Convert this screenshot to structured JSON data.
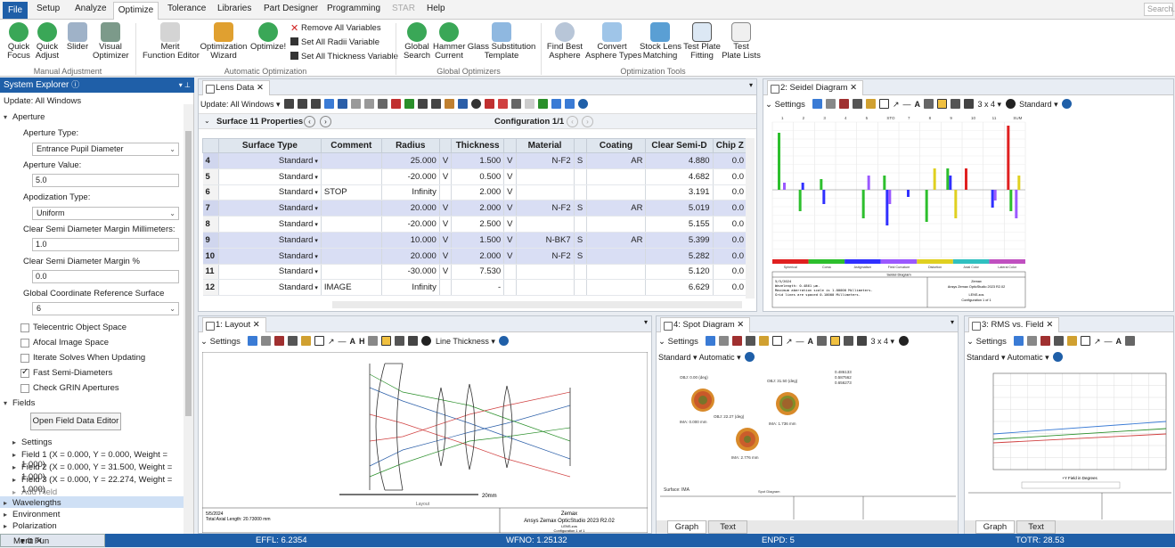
{
  "menu": {
    "file": "File",
    "setup": "Setup",
    "analyze": "Analyze",
    "optimize": "Optimize",
    "tolerance": "Tolerance",
    "libraries": "Libraries",
    "part_designer": "Part Designer",
    "programming": "Programming",
    "star": "STAR",
    "help": "Help",
    "search_placeholder": "Search..."
  },
  "ribbon": {
    "quick_focus": "Quick\nFocus",
    "quick_adjust": "Quick\nAdjust",
    "slider": "Slider",
    "visual_optimizer": "Visual\nOptimizer",
    "group_manual": "Manual Adjustment",
    "merit_editor": "Merit\nFunction Editor",
    "opt_wizard": "Optimization\nWizard",
    "optimize": "Optimize!",
    "remove_vars": "Remove All Variables",
    "set_radii": "Set All Radii Variable",
    "set_thickness": "Set All Thickness Variable",
    "group_auto": "Automatic Optimization",
    "global_search": "Global\nSearch",
    "hammer": "Hammer\nCurrent",
    "glass_sub": "Glass Substitution\nTemplate",
    "group_global": "Global Optimizers",
    "find_asphere": "Find Best\nAsphere",
    "convert_asphere": "Convert\nAsphere Types",
    "stock_lens": "Stock Lens\nMatching",
    "test_plate_fit": "Test Plate\nFitting",
    "test_plate_lists": "Test\nPlate Lists",
    "group_tools": "Optimization Tools"
  },
  "sysexp": {
    "title": "System Explorer",
    "update": "Update: All Windows",
    "aperture": "Aperture",
    "aperture_type_lbl": "Aperture Type:",
    "aperture_type": "Entrance Pupil Diameter",
    "aperture_value_lbl": "Aperture Value:",
    "aperture_value": "5.0",
    "apod_lbl": "Apodization Type:",
    "apod": "Uniform",
    "csd_mm_lbl": "Clear Semi Diameter Margin Millimeters:",
    "csd_mm": "1.0",
    "csd_pct_lbl": "Clear Semi Diameter Margin %",
    "csd_pct": "0.0",
    "gcrs_lbl": "Global Coordinate Reference Surface",
    "gcrs": "6",
    "telecentric": "Telecentric Object Space",
    "afocal": "Afocal Image Space",
    "iterate": "Iterate Solves When Updating",
    "fast_semi": "Fast Semi-Diameters",
    "check_grin": "Check GRIN Apertures",
    "fields": "Fields",
    "open_field": "Open Field Data Editor",
    "settings": "Settings",
    "field1": "Field 1 (X = 0.000, Y = 0.000, Weight = 1.000)",
    "field2": "Field 2 (X = 0.000, Y = 31.500, Weight = 1.000)",
    "field3": "Field 3 (X = 0.000, Y = 22.274, Weight = 1.000)",
    "add_field": "Add Field",
    "wavelengths": "Wavelengths",
    "environment": "Environment",
    "polarization": "Polarization"
  },
  "lens": {
    "tab": "Lens Data",
    "update": "Update: All Windows",
    "surface_label": "Surface",
    "surface_props": "11 Properties",
    "config": "Configuration 1/1",
    "headers": [
      "",
      "Surface Type",
      "Comment",
      "Radius",
      "",
      "Thickness",
      "",
      "Material",
      "",
      "Coating",
      "Clear Semi-D",
      "Chip Z"
    ],
    "rows": [
      {
        "n": "4",
        "type": "Standard",
        "comment": "",
        "radius": "25.000",
        "rs": "V",
        "thick": "1.500",
        "ts": "V",
        "mat": "N-F2",
        "ms": "S",
        "coat": "AR",
        "csd": "4.880",
        "chip": "0.0",
        "sel": true
      },
      {
        "n": "5",
        "type": "Standard",
        "comment": "",
        "radius": "-20.000",
        "rs": "V",
        "thick": "0.500",
        "ts": "V",
        "mat": "",
        "ms": "",
        "coat": "",
        "csd": "4.682",
        "chip": "0.0",
        "sel": false
      },
      {
        "n": "6",
        "type": "Standard",
        "comment": "STOP",
        "radius": "Infinity",
        "rs": "",
        "thick": "2.000",
        "ts": "V",
        "mat": "",
        "ms": "",
        "coat": "",
        "csd": "3.191",
        "chip": "0.0",
        "sel": false
      },
      {
        "n": "7",
        "type": "Standard",
        "comment": "",
        "radius": "20.000",
        "rs": "V",
        "thick": "2.000",
        "ts": "V",
        "mat": "N-F2",
        "ms": "S",
        "coat": "AR",
        "csd": "5.019",
        "chip": "0.0",
        "sel": true
      },
      {
        "n": "8",
        "type": "Standard",
        "comment": "",
        "radius": "-20.000",
        "rs": "V",
        "thick": "2.500",
        "ts": "V",
        "mat": "",
        "ms": "",
        "coat": "",
        "csd": "5.155",
        "chip": "0.0",
        "sel": false
      },
      {
        "n": "9",
        "type": "Standard",
        "comment": "",
        "radius": "10.000",
        "rs": "V",
        "thick": "1.500",
        "ts": "V",
        "mat": "N-BK7",
        "ms": "S",
        "coat": "AR",
        "csd": "5.399",
        "chip": "0.0",
        "sel": true
      },
      {
        "n": "10",
        "type": "Standard",
        "comment": "",
        "radius": "20.000",
        "rs": "V",
        "thick": "2.000",
        "ts": "V",
        "mat": "N-F2",
        "ms": "S",
        "coat": "",
        "csd": "5.282",
        "chip": "0.0",
        "sel": true
      },
      {
        "n": "11",
        "type": "Standard",
        "comment": "",
        "radius": "-30.000",
        "rs": "V",
        "thick": "7.530",
        "ts": "",
        "mat": "",
        "ms": "",
        "coat": "",
        "csd": "5.120",
        "chip": "0.0",
        "sel": false
      },
      {
        "n": "12",
        "type": "Standard",
        "comment": "IMAGE",
        "radius": "Infinity",
        "rs": "",
        "thick": "-",
        "ts": "",
        "mat": "",
        "ms": "",
        "coat": "",
        "csd": "6.629",
        "chip": "0.0",
        "sel": false
      }
    ]
  },
  "seidel": {
    "tab": "2: Seidel Diagram",
    "settings": "Settings",
    "grid": "3 x 4",
    "standard": "Standard",
    "stop": "STO",
    "sum": "SUM",
    "legend": [
      "Spherical",
      "Coma",
      "Astigmatism",
      "Field Curvature",
      "Distortion",
      "Axial Color",
      "Lateral Color"
    ],
    "legend_colors": [
      "#e02020",
      "#2dbf2d",
      "#3030ff",
      "#9b59ff",
      "#e0d020",
      "#30c0c0",
      "#c050c0"
    ],
    "footer_title": "Seidel Diagram",
    "footer_lines": [
      "5/5/2024",
      "Wavelength: 0.4861 µm.",
      "Maximum aberration scale is 1.00000 Millimeters.",
      "Grid lines are spaced 0.10000 Millimeters."
    ],
    "footer_company": "Zemax",
    "footer_product": "Ansys Zemax OpticStudio 2023 R2.02",
    "footer_file": "LENS.zos",
    "footer_config": "Configuration 1 of 1"
  },
  "layout": {
    "tab": "1: Layout",
    "settings": "Settings",
    "line_thickness": "Line Thickness",
    "scale": "20mm",
    "caption": "Layout",
    "date": "5/5/2024",
    "total_axial": "Total Axial Length:  20.73000 mm",
    "company": "Zemax",
    "product": "Ansys Zemax OpticStudio 2023 R2.02",
    "file": "LENS.zos",
    "config": "Configuration 1 of 1"
  },
  "spot": {
    "tab": "4: Spot Diagram",
    "settings": "Settings",
    "grid": "3 x 4",
    "standard": "Standard",
    "automatic": "Automatic",
    "labels": [
      "OBJ: 0.00 (deg)",
      "OBJ: 31.50 (deg)",
      "OBJ: 22.27 (deg)"
    ],
    "ima": [
      "IMA: 0.000 mm",
      "IMA: 1.736 mm",
      "IMA: 2.776 mm"
    ],
    "legend": [
      "0.486133",
      "0.587562",
      "0.656273"
    ],
    "surface": "Surface: IMA",
    "caption": "Spot Diagram",
    "tab_graph": "Graph",
    "tab_text": "Text"
  },
  "rms": {
    "tab": "3: RMS vs. Field",
    "settings": "Settings",
    "standard": "Standard",
    "automatic": "Automatic",
    "xlabel": "+Y Field in Degrees",
    "tab_graph": "Graph",
    "tab_text": "Text"
  },
  "status": {
    "merit": "Merit Fun",
    "effl": "EFFL: 6.2354",
    "wfno": "WFNO: 1.25132",
    "enpd": "ENPD: 5",
    "totr": "TOTR: 28.53"
  }
}
